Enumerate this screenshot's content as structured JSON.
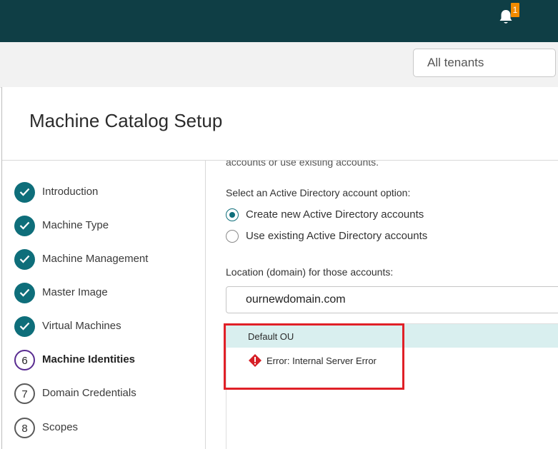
{
  "header": {
    "notification_count": "1",
    "colors": {
      "topbar": "#0f3e45",
      "badge": "#f28b00"
    }
  },
  "tenant_selector": {
    "value": "All tenants"
  },
  "panel": {
    "title": "Machine Catalog Setup"
  },
  "steps": [
    {
      "label": "Introduction",
      "state": "done",
      "number": ""
    },
    {
      "label": "Machine Type",
      "state": "done",
      "number": ""
    },
    {
      "label": "Machine Management",
      "state": "done",
      "number": ""
    },
    {
      "label": "Master Image",
      "state": "done",
      "number": ""
    },
    {
      "label": "Virtual Machines",
      "state": "done",
      "number": ""
    },
    {
      "label": "Machine Identities",
      "state": "current",
      "number": "6"
    },
    {
      "label": "Domain Credentials",
      "state": "pending",
      "number": "7"
    },
    {
      "label": "Scopes",
      "state": "pending",
      "number": "8"
    }
  ],
  "content": {
    "cut_off_text": "accounts or use existing accounts.",
    "account_option_label": "Select an Active Directory account option:",
    "radio_options": [
      {
        "label": "Create new Active Directory accounts",
        "selected": true
      },
      {
        "label": "Use existing Active Directory accounts",
        "selected": false
      }
    ],
    "location_label": "Location (domain) for those accounts:",
    "domain_value": "ournewdomain.com",
    "tree": {
      "selected_item": "Default OU",
      "error_message": "Error: Internal Server Error",
      "error_icon": "error-diamond-icon"
    },
    "accent_color": "#0e6e7a",
    "current_step_color": "#5a2d91",
    "annotation_color": "#e02027"
  }
}
